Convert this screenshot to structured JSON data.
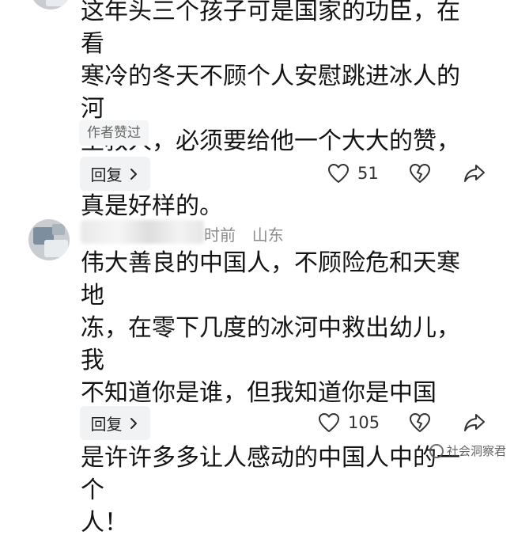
{
  "comments": [
    {
      "text_lines": [
        "这年头三个孩子可是国家的功臣，在看",
        "寒冷的冬天不顾个人安慰跳进冰人的河",
        "里救人，必须要给他一个大大的赞，你",
        "真是好样的。"
      ],
      "tag": "作者赞过",
      "reply_label": "回复",
      "like_count": "51"
    },
    {
      "name_visible": "时前",
      "location": "山东",
      "text_lines": [
        "伟大善良的中国人，不顾险危和天寒地",
        "冻，在零下几度的冰河中救出幼儿，我",
        "不知道你是谁，但我知道你是中国人，",
        "是许许多多让人感动的中国人中的一个",
        "人！"
      ],
      "reply_label": "回复",
      "like_count": "105"
    }
  ],
  "watermark": "社会洞察君"
}
